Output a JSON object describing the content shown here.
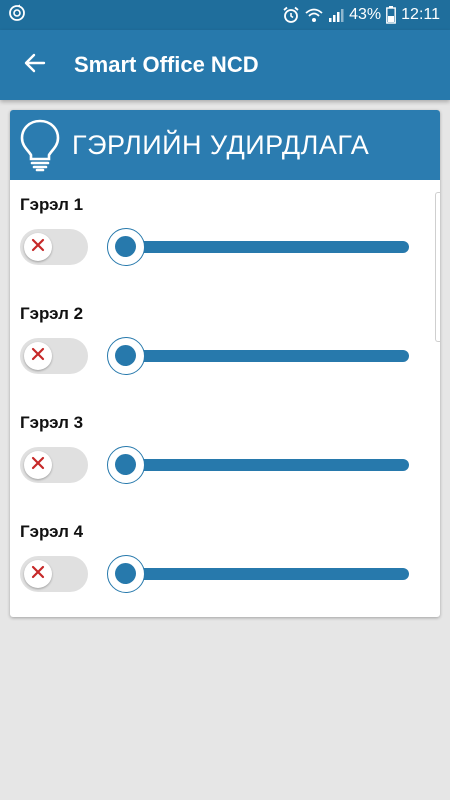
{
  "status_bar": {
    "battery": "43%",
    "time": "12:11"
  },
  "app_bar": {
    "title": "Smart Office NCD"
  },
  "card": {
    "title": "ГЭРЛИЙН УДИРДЛАГА",
    "lights": [
      {
        "label": "Гэрэл 1",
        "on": false,
        "level": 0
      },
      {
        "label": "Гэрэл 2",
        "on": false,
        "level": 0
      },
      {
        "label": "Гэрэл 3",
        "on": false,
        "level": 0
      },
      {
        "label": "Гэрэл 4",
        "on": false,
        "level": 0
      }
    ]
  },
  "colors": {
    "primary": "#2779ac",
    "status_bar": "#1f6e9c",
    "toggle_off_x": "#c62828"
  }
}
